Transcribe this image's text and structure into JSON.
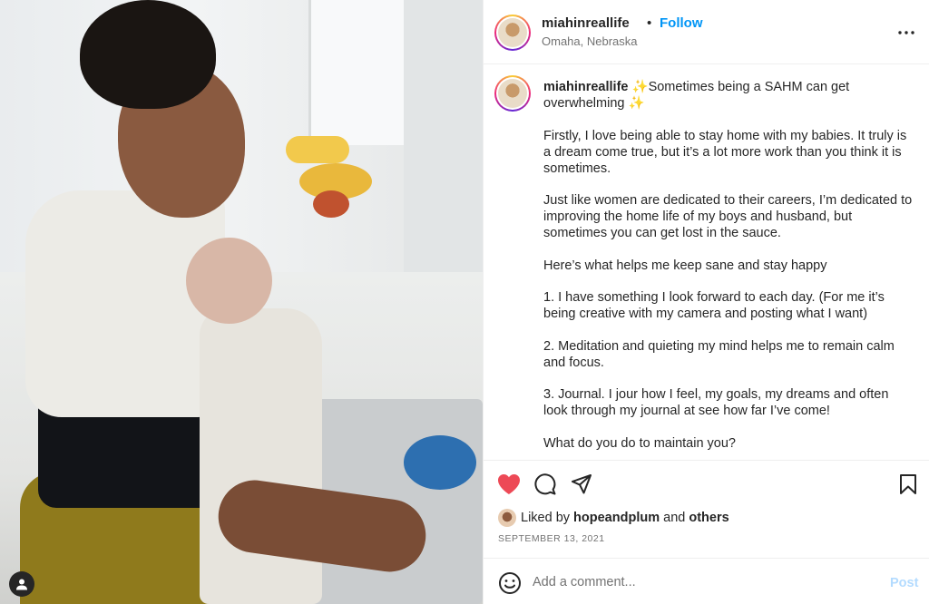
{
  "post": {
    "username": "miahinreallife",
    "follow_label": "Follow",
    "location": "Omaha, Nebraska"
  },
  "caption": {
    "username": "miahinreallife",
    "lines": [
      "✨Sometimes being a SAHM can get overwhelming ✨",
      "Firstly, I love being able to stay home with my babies. It truly is a dream come true, but it’s a lot more work than you think it is sometimes.",
      "Just like women are dedicated to their careers, I’m dedicated to improving the home life of my boys and husband, but sometimes you can get lost in the sauce.",
      "Here’s what helps me keep sane and stay happy",
      "1. I have something I look forward to each day. (For me it’s being creative with my camera and posting what I want)",
      "2. Meditation and quieting my mind helps me to remain calm and focus.",
      "3. Journal. I jour how I feel, my goals, my dreams and often look through my journal at see how far I’ve come!",
      "What do you do to maintain you?"
    ]
  },
  "likes": {
    "prefix": "Liked by",
    "user": "hopeandplum",
    "conj": "and",
    "others": "others"
  },
  "date": "SEPTEMBER 13, 2021",
  "comment": {
    "placeholder": "Add a comment...",
    "post_label": "Post"
  },
  "colors": {
    "like_red": "#ed4956",
    "link_blue": "#0095f6",
    "post_disabled": "#b3dbff"
  },
  "icons": {
    "like": "heart-filled-icon",
    "comment": "comment-bubble-icon",
    "share": "paper-plane-icon",
    "save": "bookmark-icon",
    "more": "more-dots-icon",
    "emoji": "emoji-smile-icon",
    "user_tag": "user-tag-icon"
  }
}
